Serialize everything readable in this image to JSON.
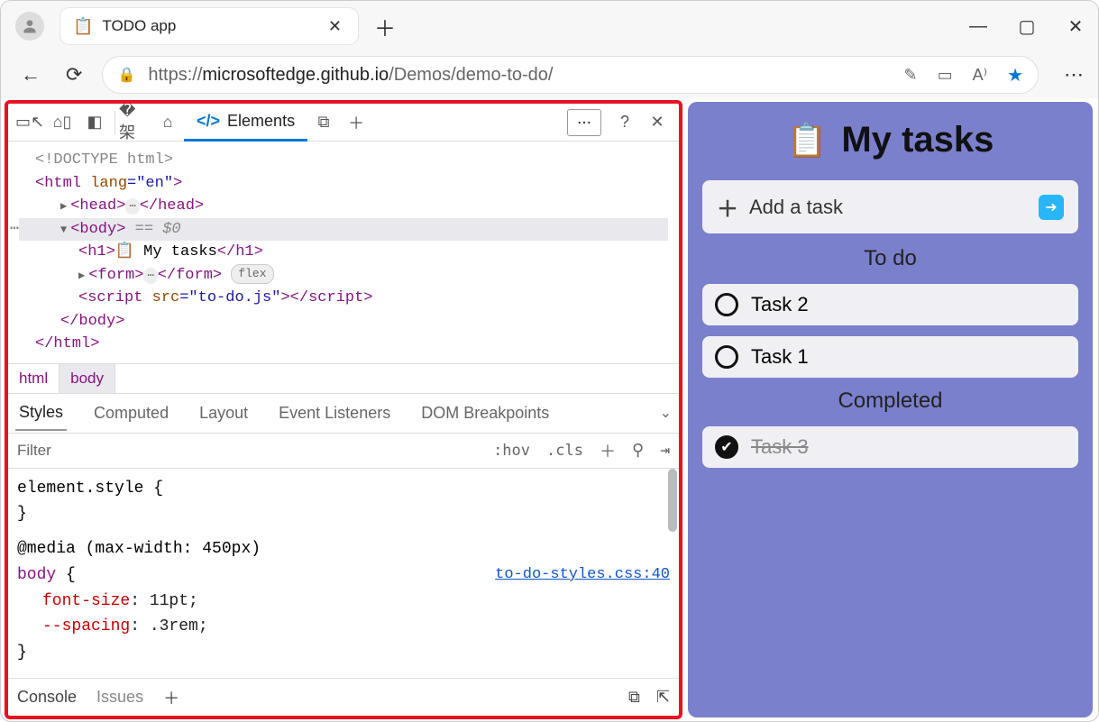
{
  "browser": {
    "tab_title": "TODO app",
    "url_pre": "https://",
    "url_domain": "microsoftedge.github.io",
    "url_path": "/Demos/demo-to-do/"
  },
  "devtools": {
    "top_tab": "Elements",
    "dom": {
      "l0": "<!DOCTYPE html>",
      "l1a": "<html ",
      "l1b": "lang",
      "l1c": "=\"en\"",
      "l1d": ">",
      "l2a": "<head>",
      "l2b": "</head>",
      "l3a": "<body>",
      "l3b": " == $0",
      "l4a": "<h1>",
      "l4b": " My tasks",
      "l4c": "</h1>",
      "l5a": "<form>",
      "l5b": "</form>",
      "l5c": "flex",
      "l6a": "<script ",
      "l6b": "src",
      "l6c": "=\"to-do.js\"",
      "l6d": "></",
      "l6e": "script>",
      "l7": "</body>",
      "l8": "</html>"
    },
    "crumbs": {
      "html": "html",
      "body": "body"
    },
    "styles_tabs": [
      "Styles",
      "Computed",
      "Layout",
      "Event Listeners",
      "DOM Breakpoints"
    ],
    "filter_placeholder": "Filter",
    "hov": ":hov",
    "cls": ".cls",
    "css": {
      "r1": "element.style {",
      "r2": "}",
      "r3": "@media (max-width: 450px)",
      "r4_sel": "body",
      "r4_link": "to-do-styles.css:40",
      "r5_n": "font-size",
      "r5_v": ": 11pt;",
      "r6_n": "--spacing",
      "r6_v": ": .3rem;",
      "r7": "}"
    },
    "drawer": {
      "console": "Console",
      "issues": "Issues"
    }
  },
  "app": {
    "title": "My tasks",
    "add": "Add a task",
    "todo_h": "To do",
    "done_h": "Completed",
    "todo": [
      "Task 2",
      "Task 1"
    ],
    "done": [
      "Task 3"
    ]
  }
}
